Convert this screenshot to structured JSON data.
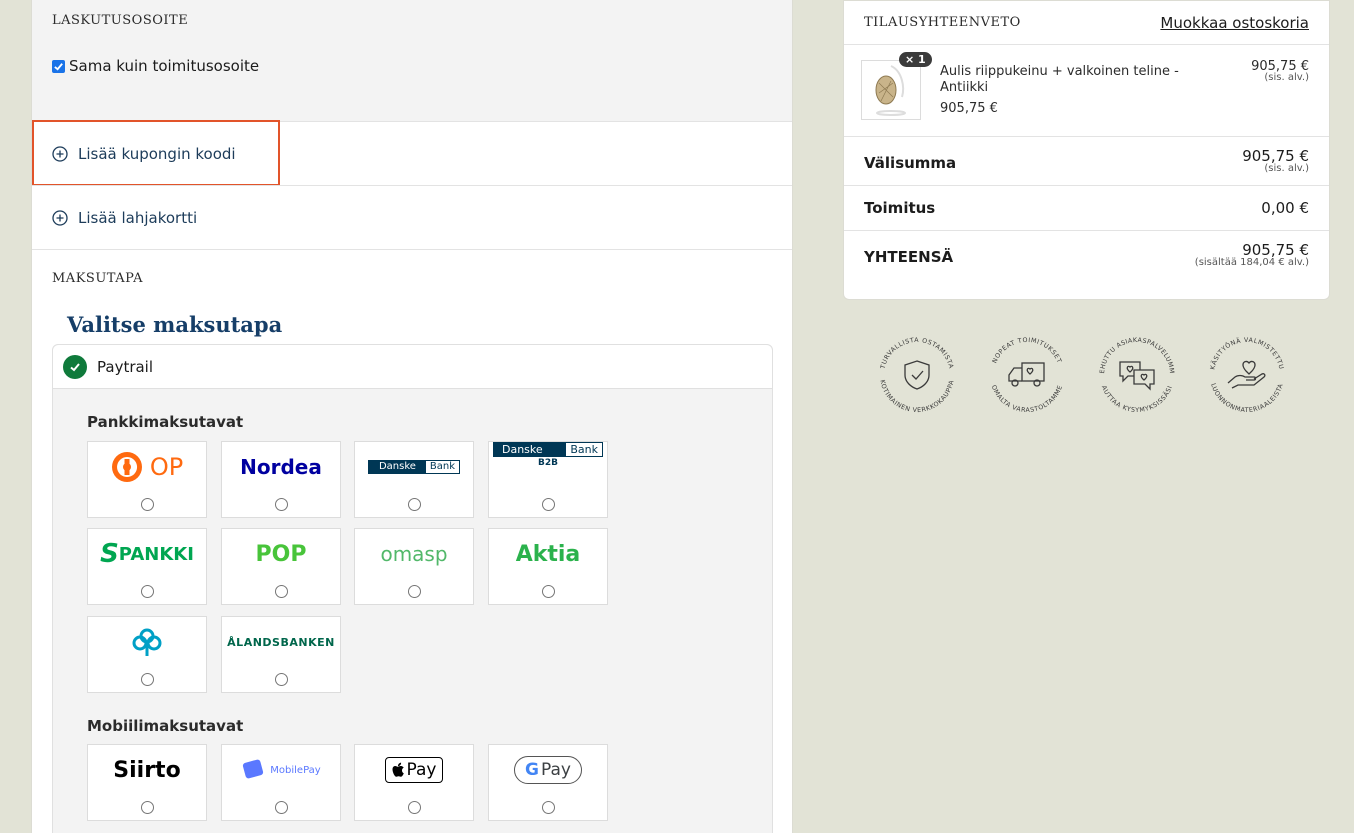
{
  "billing": {
    "title": "LASKUTUSOSOITE",
    "same_as_shipping_label": "Sama kuin toimitusosoite",
    "same_as_shipping_checked": true
  },
  "coupon": {
    "label": "Lisää kupongin koodi"
  },
  "giftcard": {
    "label": "Lisää lahjakortti"
  },
  "payment": {
    "title": "MAKSUTAPA",
    "heading": "Valitse maksutapa",
    "provider": "Paytrail",
    "bank_group_title": "Pankkimaksutavat",
    "banks": [
      {
        "name": "OP",
        "icon": "op-logo"
      },
      {
        "name": "Nordea",
        "icon": "nordea-logo"
      },
      {
        "name": "Danske Bank",
        "icon": "danske-logo"
      },
      {
        "name": "Danske Bank B2B",
        "icon": "danske-b2b-logo"
      },
      {
        "name": "S-PANKKI",
        "icon": "spankki-logo"
      },
      {
        "name": "POP",
        "icon": "pop-logo"
      },
      {
        "name": "omaSP",
        "icon": "omasp-logo"
      },
      {
        "name": "Aktia",
        "icon": "aktia-logo"
      },
      {
        "name": "Säästöpankki",
        "icon": "saastopankki-logo"
      },
      {
        "name": "ÅLANDSBANKEN",
        "icon": "alandsbanken-logo"
      }
    ],
    "mobile_group_title": "Mobiilimaksutavat",
    "mobile": [
      {
        "name": "Siirto",
        "icon": "siirto-logo"
      },
      {
        "name": "MobilePay",
        "icon": "mobilepay-logo"
      },
      {
        "name": "Apple Pay",
        "icon": "applepay-logo"
      },
      {
        "name": "Google Pay",
        "icon": "googlepay-logo"
      }
    ],
    "logo_text": {
      "op": "OP",
      "nordea": "Nordea",
      "danske": "Danske",
      "bank": "Bank",
      "b2b": "B2B",
      "spankki": "PANKKI",
      "pop": "POP",
      "omasp": "omasp",
      "aktia": "Aktia",
      "alandsbanken": "ÅLANDSBANKEN",
      "siirto": "Siirto",
      "mobilepay": "MobilePay",
      "applepay": "Pay",
      "googlepay": "Pay"
    }
  },
  "summary": {
    "title": "TILAUSYHTEENVETO",
    "edit_link": "Muokkaa ostoskoria",
    "product": {
      "quantity": "× 1",
      "name": "Aulis riippukeinu + valkoinen teline - Antiikki",
      "unit_price": "905,75 €",
      "line_total": "905,75 €",
      "vat_note": "(sis. alv.)"
    },
    "subtotal_label": "Välisumma",
    "subtotal_value": "905,75 €",
    "subtotal_note": "(sis. alv.)",
    "shipping_label": "Toimitus",
    "shipping_value": "0,00 €",
    "total_label": "YHTEENSÄ",
    "total_value": "905,75 €",
    "total_note": "(sisältää 184,04 € alv.)"
  },
  "badges": [
    {
      "top": "TURVALLISTA OSTAMISTA",
      "bottom": "KOTIMAINEN VERKKOKAUPPA",
      "icon": "shield-check-icon"
    },
    {
      "top": "NOPEAT TOIMITUKSET",
      "bottom": "OMALTA VARASTOLTAMME",
      "icon": "truck-icon"
    },
    {
      "top": "KEHUTTU ASIAKASPALVELUMME",
      "bottom": "AUTTAA KYSYMYKSISSÄSI",
      "icon": "chat-heart-icon"
    },
    {
      "top": "KÄSITYÖNÄ VALMISTETTU",
      "bottom": "LUONNONMATERIAALEISTA",
      "icon": "hand-heart-icon"
    }
  ],
  "colors": {
    "accent_navy": "#163e68",
    "highlight_orange": "#e2542a",
    "check_green": "#0f7a3b",
    "page_bg": "#e2e3d6"
  }
}
